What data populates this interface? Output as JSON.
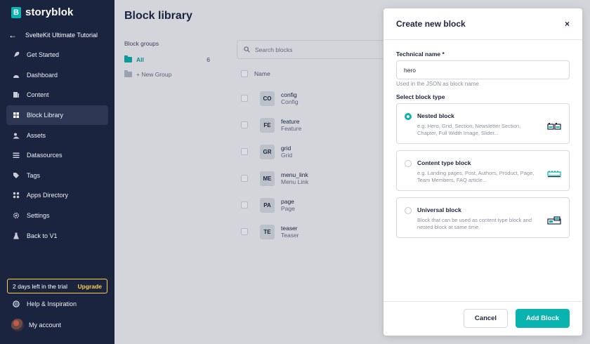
{
  "sidebar": {
    "logo_text": "storyblok",
    "logo_letter": "B",
    "project": "SvelteKit Ultimate Tutorial",
    "items": [
      {
        "label": "Get Started",
        "icon": "rocket-icon"
      },
      {
        "label": "Dashboard",
        "icon": "gauge-icon"
      },
      {
        "label": "Content",
        "icon": "content-icon"
      },
      {
        "label": "Block Library",
        "icon": "blocks-icon",
        "active": true
      },
      {
        "label": "Assets",
        "icon": "image-icon"
      },
      {
        "label": "Datasources",
        "icon": "list-icon"
      },
      {
        "label": "Tags",
        "icon": "tag-icon"
      },
      {
        "label": "Apps Directory",
        "icon": "apps-icon"
      },
      {
        "label": "Settings",
        "icon": "gear-icon"
      },
      {
        "label": "Back to V1",
        "icon": "flask-icon"
      }
    ],
    "trial_text": "2 days left in the trial",
    "upgrade": "Upgrade",
    "help": "Help & Inspiration",
    "account": "My account"
  },
  "main": {
    "title": "Block library",
    "groups_title": "Block groups",
    "group_all": "All",
    "group_all_count": "6",
    "new_group": "+ New Group",
    "search_placeholder": "Search blocks",
    "column_name": "Name",
    "blocks": [
      {
        "abbr": "CO",
        "name": "config",
        "display": "Config"
      },
      {
        "abbr": "FE",
        "name": "feature",
        "display": "Feature"
      },
      {
        "abbr": "GR",
        "name": "grid",
        "display": "Grid"
      },
      {
        "abbr": "ME",
        "name": "menu_link",
        "display": "Menu Link"
      },
      {
        "abbr": "PA",
        "name": "page",
        "display": "Page"
      },
      {
        "abbr": "TE",
        "name": "teaser",
        "display": "Teaser"
      }
    ]
  },
  "modal": {
    "title": "Create new block",
    "close": "×",
    "tech_label": "Technical name *",
    "tech_value": "hero",
    "tech_hint": "Used in the JSON as block name",
    "type_label": "Select block type",
    "options": [
      {
        "title": "Nested block",
        "desc": "e.g. Hero, Grid, Section, Newsletter Section, Chapter, Full Width Image, Slider...",
        "selected": true
      },
      {
        "title": "Content type block",
        "desc": "e.g. Landing pages, Post, Authors, Product, Page, Team Members, FAQ article...",
        "selected": false
      },
      {
        "title": "Universal block",
        "desc": "Block that can be used as content type block and nested block at same time.",
        "selected": false
      }
    ],
    "cancel": "Cancel",
    "add": "Add Block"
  },
  "colors": {
    "accent": "#09b3af",
    "sidebar": "#1b243f",
    "trial": "#ffce4a"
  }
}
